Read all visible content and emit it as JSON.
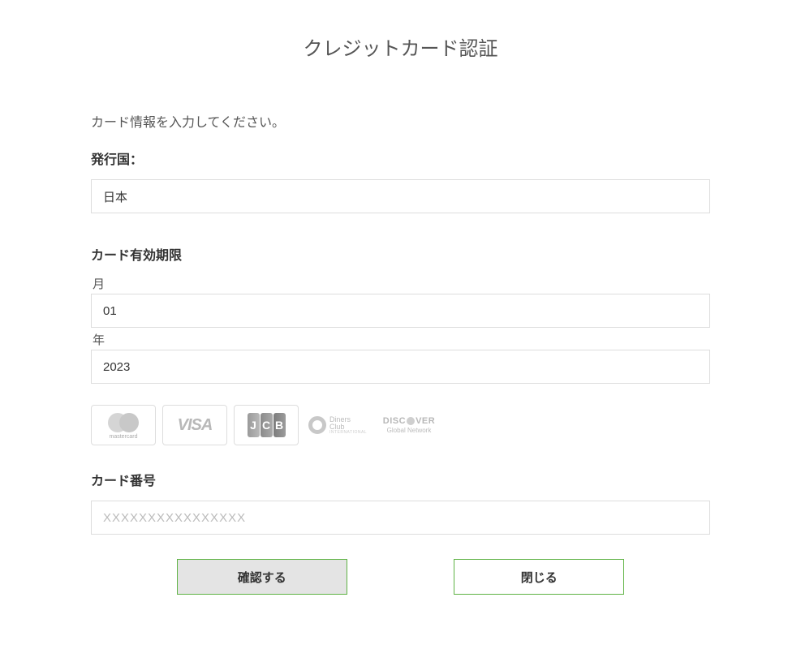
{
  "title": "クレジットカード認証",
  "instruction": "カード情報を入力してください。",
  "country": {
    "label": "発行国：",
    "value": "日本"
  },
  "expiry": {
    "label": "カード有効期限",
    "month_label": "月",
    "month_value": "01",
    "year_label": "年",
    "year_value": "2023"
  },
  "card_number": {
    "label": "カード番号",
    "placeholder": "XXXXXXXXXXXXXXXX",
    "value": ""
  },
  "buttons": {
    "confirm": "確認する",
    "close": "閉じる"
  },
  "card_brands": [
    "mastercard",
    "visa",
    "jcb",
    "diners-club",
    "discover"
  ]
}
